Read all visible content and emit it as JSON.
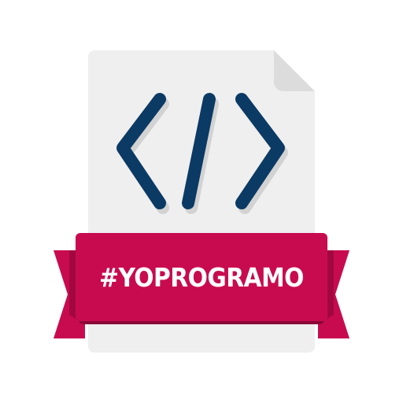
{
  "badge": {
    "text": "#YOPROGRAMO"
  },
  "icon": {
    "name": "code-file-icon",
    "symbol_name": "code-brackets-icon"
  },
  "colors": {
    "paper": "#efefef",
    "paper_fold": "#dcdcdc",
    "paper_shadow": "#d7d7d7",
    "code_stroke": "#0b3a64",
    "ribbon": "#c80b4f",
    "ribbon_dark": "#a30740",
    "ribbon_shadow": "#8b0636",
    "text": "#ffffff"
  }
}
